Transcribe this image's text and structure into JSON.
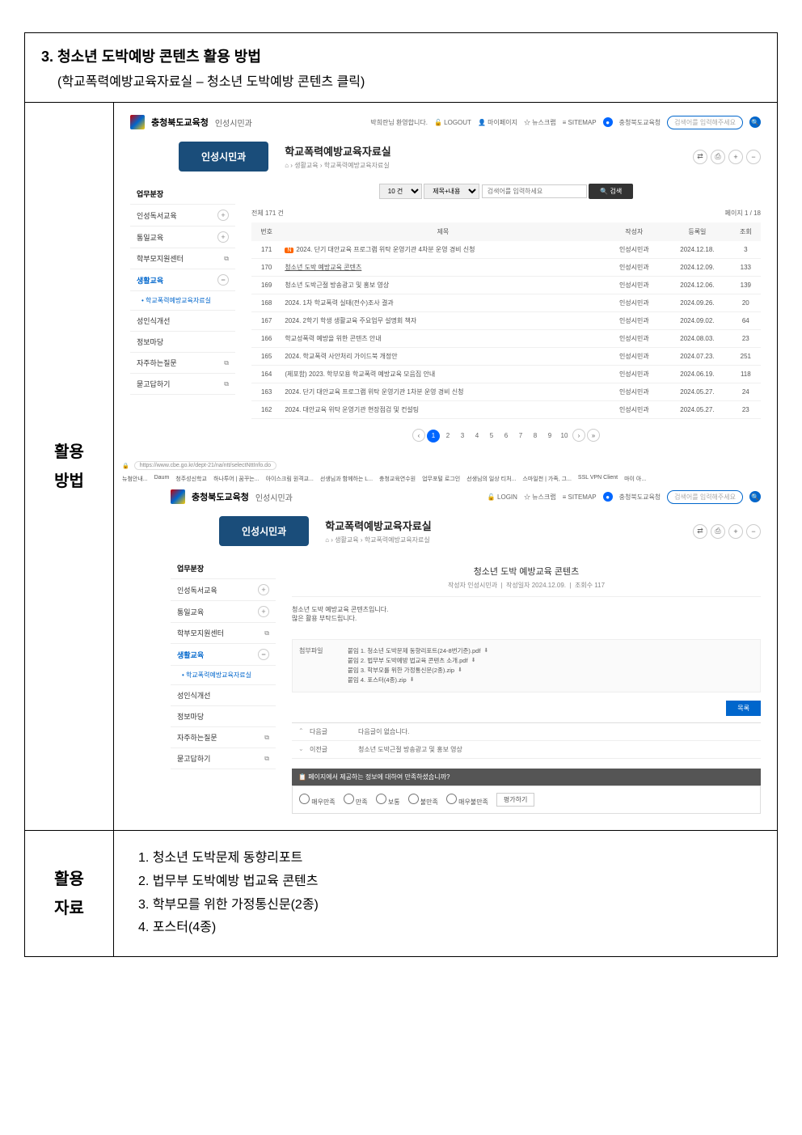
{
  "header": {
    "section_num": "3.",
    "section_title": "청소년 도박예방 콘텐츠 활용 방법",
    "section_sub": "(학교폭력예방교육자료실 – 청소년 도박예방 콘텐츠 클릭)"
  },
  "row1_label_line1": "활용",
  "row1_label_line2": "방법",
  "shot1": {
    "logo_main": "충청북도교육청",
    "logo_sub": "인성시민과",
    "welcome": "박희란님 환영합니다.",
    "logout": "LOGOUT",
    "mypage": "마이페이지",
    "newsclip": "뉴스크랩",
    "sitemap": "SITEMAP",
    "badge_label": "충청북도교육청",
    "search_placeholder": "검색어를 입력해주세요",
    "blue_tab": "인성시민과",
    "page_title": "학교폭력예방교육자료실",
    "breadcrumb_home": "⌂",
    "breadcrumb_1": "생활교육",
    "breadcrumb_2": "학교폭력예방교육자료실",
    "icons": {
      "share": "⇄",
      "print": "⎙",
      "plus": "+",
      "minus": "−"
    },
    "sidebar": {
      "items": [
        {
          "label": "업무분장",
          "type": "bold"
        },
        {
          "label": "인성독서교육",
          "type": "plus"
        },
        {
          "label": "통일교육",
          "type": "plus"
        },
        {
          "label": "학부모지원센터",
          "type": "link"
        },
        {
          "label": "생활교육",
          "type": "active-minus"
        },
        {
          "label": "• 학교폭력예방교육자료실",
          "type": "sub"
        },
        {
          "label": "성인식개선",
          "type": "plain"
        },
        {
          "label": "정보마당",
          "type": "plain"
        },
        {
          "label": "자주하는질문",
          "type": "link"
        },
        {
          "label": "묻고답하기",
          "type": "link"
        }
      ]
    },
    "search_row": {
      "per_page": "10 건",
      "field": "제목+내용",
      "placeholder": "검색어를 입력하세요",
      "button": "검색"
    },
    "count_total": "전체 171 건",
    "count_page": "페이지 1 / 18",
    "columns": {
      "num": "번호",
      "title": "제목",
      "author": "작성자",
      "date": "등록일",
      "views": "조회"
    },
    "rows": [
      {
        "num": "171",
        "notice": true,
        "title": "2024. 단기 대안교육 프로그램 위탁 운영기관 4차분 운영 경비 신청",
        "author": "인성시민과",
        "date": "2024.12.18.",
        "views": "3"
      },
      {
        "num": "170",
        "title": "청소년 도박 예방교육 콘텐츠",
        "author": "인성시민과",
        "date": "2024.12.09.",
        "views": "133",
        "link": true
      },
      {
        "num": "169",
        "title": "청소년 도박근절 방송광고 및 홍보 영상",
        "author": "인성시민과",
        "date": "2024.12.06.",
        "views": "139"
      },
      {
        "num": "168",
        "title": "2024. 1차 학교폭력 실태(전수)조사 결과",
        "author": "인성시민과",
        "date": "2024.09.26.",
        "views": "20"
      },
      {
        "num": "167",
        "title": "2024. 2학기 학생 생활교육 주요업무 설명회 책자",
        "author": "인성시민과",
        "date": "2024.09.02.",
        "views": "64"
      },
      {
        "num": "166",
        "title": "학교성폭력 예방을 위한 콘텐츠 안내",
        "author": "인성시민과",
        "date": "2024.08.03.",
        "views": "23"
      },
      {
        "num": "165",
        "title": "2024. 학교폭력 사안처리 가이드북 개정안",
        "author": "인성시민과",
        "date": "2024.07.23.",
        "views": "251"
      },
      {
        "num": "164",
        "title": "(제포함) 2023. 학부모용 학교폭력 예방교육 모음집 안내",
        "author": "인성시민과",
        "date": "2024.06.19.",
        "views": "118"
      },
      {
        "num": "163",
        "title": "2024. 단기 대안교육 프로그램 위탁 운영기관 1차분 운영 경비 신청",
        "author": "인성시민과",
        "date": "2024.05.27.",
        "views": "24"
      },
      {
        "num": "162",
        "title": "2024. 대안교육 위탁 운영기관 현장점검 및 컨설팅",
        "author": "인성시민과",
        "date": "2024.05.27.",
        "views": "23"
      }
    ],
    "pagination": {
      "prev": "‹",
      "pages": [
        "1",
        "2",
        "3",
        "4",
        "5",
        "6",
        "7",
        "8",
        "9",
        "10"
      ],
      "next": "›",
      "last": "»"
    }
  },
  "browser": {
    "url": "https://www.cbe.go.kr/dept-21/na/ntt/selectNttInfo.do",
    "bookmarks": [
      "뉴첨안내...",
      "Daum",
      "청주성신학교",
      "하나투어 | 꿈꾸는...",
      "아이스크림 원격교...",
      "선생님과 함께하는 L...",
      "충청교육연수원",
      "업무포털 로그인",
      "선생님의 일상 티처...",
      "스마일천 | 가족, 그...",
      "SSL VPN Client",
      "마이 아..."
    ]
  },
  "shot2": {
    "login": "LOGIN",
    "detail_title": "청소년 도박 예방교육 콘텐츠",
    "meta_author_label": "작성자",
    "meta_author": "인성시민과",
    "meta_date_label": "작성일자",
    "meta_date": "2024.12.09.",
    "meta_views_label": "조회수",
    "meta_views": "117",
    "body_line1": "청소년 도박 예방교육 콘텐츠입니다.",
    "body_line2": "많은 활용 부탁드립니다.",
    "attach_label": "첨부파일",
    "attachments": [
      "붙임 1. 청소년 도박문제 동향리포트(24-8번기준).pdf",
      "붙임 2. 법무부 도박예방 법교육 콘텐츠 소개.pdf",
      "붙임 3. 학부모를 위한 가정통신문(2종).zip",
      "붙임 4. 포스터(4종).zip"
    ],
    "list_btn": "목록",
    "nav_next_label": "다음글",
    "nav_next_text": "다음글이 없습니다.",
    "nav_prev_label": "이전글",
    "nav_prev_text": "청소년 도박근절 방송광고 및 홍보 영상",
    "survey_header": "페이지에서 제공하는 정보에 대하여 만족하셨습니까?",
    "survey_options": [
      "매우만족",
      "만족",
      "보통",
      "불만족",
      "매우불만족"
    ],
    "survey_submit": "평가하기"
  },
  "row2_label_line1": "활용",
  "row2_label_line2": "자료",
  "resources": [
    "1. 청소년 도박문제 동향리포트",
    "2. 법무부 도박예방 법교육 콘텐츠",
    "3. 학부모를 위한 가정통신문(2종)",
    "4. 포스터(4종)"
  ]
}
